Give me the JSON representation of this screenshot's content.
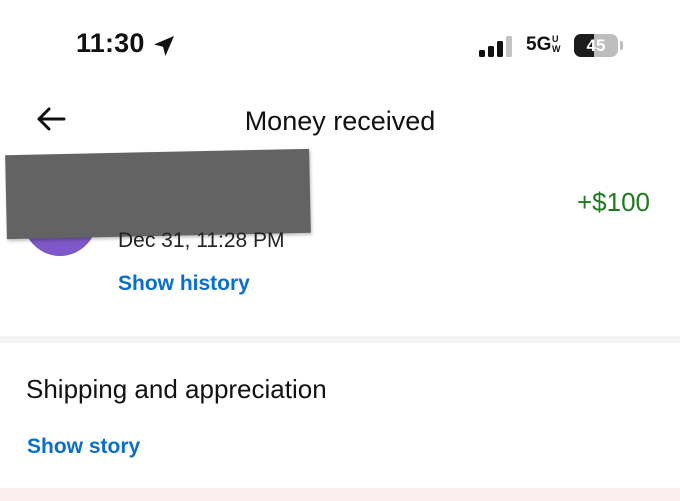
{
  "status_bar": {
    "time": "11:30",
    "location_icon": "location-arrow-icon",
    "signal_icon": "cellular-signal-icon",
    "signal_bars_active": 3,
    "signal_bars_total": 4,
    "network": "5G",
    "network_sup": "UW",
    "battery_level": "45",
    "battery_percent": 45
  },
  "header": {
    "back_icon": "back-arrow-icon",
    "title": "Money received"
  },
  "transaction": {
    "amount": "+$100",
    "amount_color": "#1e7a1e",
    "date": "Dec 31, 11:28 PM",
    "show_history_label": "Show history",
    "avatar_color": "#7e57c8"
  },
  "details": {
    "heading": "Shipping and appreciation",
    "show_story_label": "Show story"
  },
  "colors": {
    "link": "#0a6ed1",
    "positive": "#1e7a1e"
  }
}
